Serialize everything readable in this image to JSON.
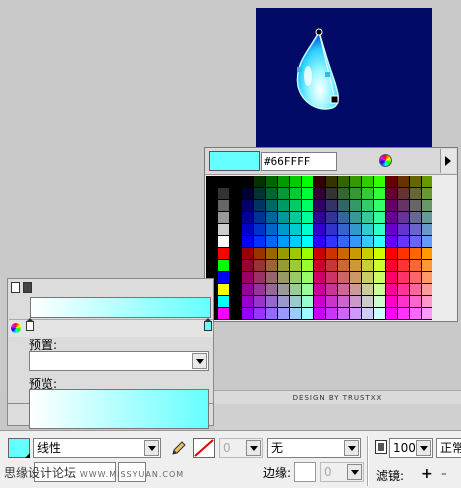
{
  "swatch": {
    "hex": "#66FFFF",
    "preview_color": "#66ffff"
  },
  "color_panel": {
    "preset_label": "预置:",
    "preset_value": "",
    "preview_label": "预览:",
    "gradient_start": "#ffffff",
    "gradient_end": "#66ffff"
  },
  "credit": "DESIGN BY TRUSTXX",
  "property_bar": {
    "fill_type": "线性",
    "stroke_width": "0",
    "stroke_style": "无",
    "alpha": "100",
    "blend_mode": "正常",
    "edge_label": "边缘:",
    "edge_value": "0",
    "filter_label": "滤镜:",
    "add_filter": "+",
    "remove_filter": "-"
  },
  "watermark": {
    "text": "思缘设计论坛",
    "url": "WWW.MISSYUAN.COM"
  },
  "icons": {
    "wheel": "color-wheel-icon",
    "menu": "menu-arrow-icon",
    "pencil": "pencil-icon",
    "alpha": "alpha-icon"
  }
}
